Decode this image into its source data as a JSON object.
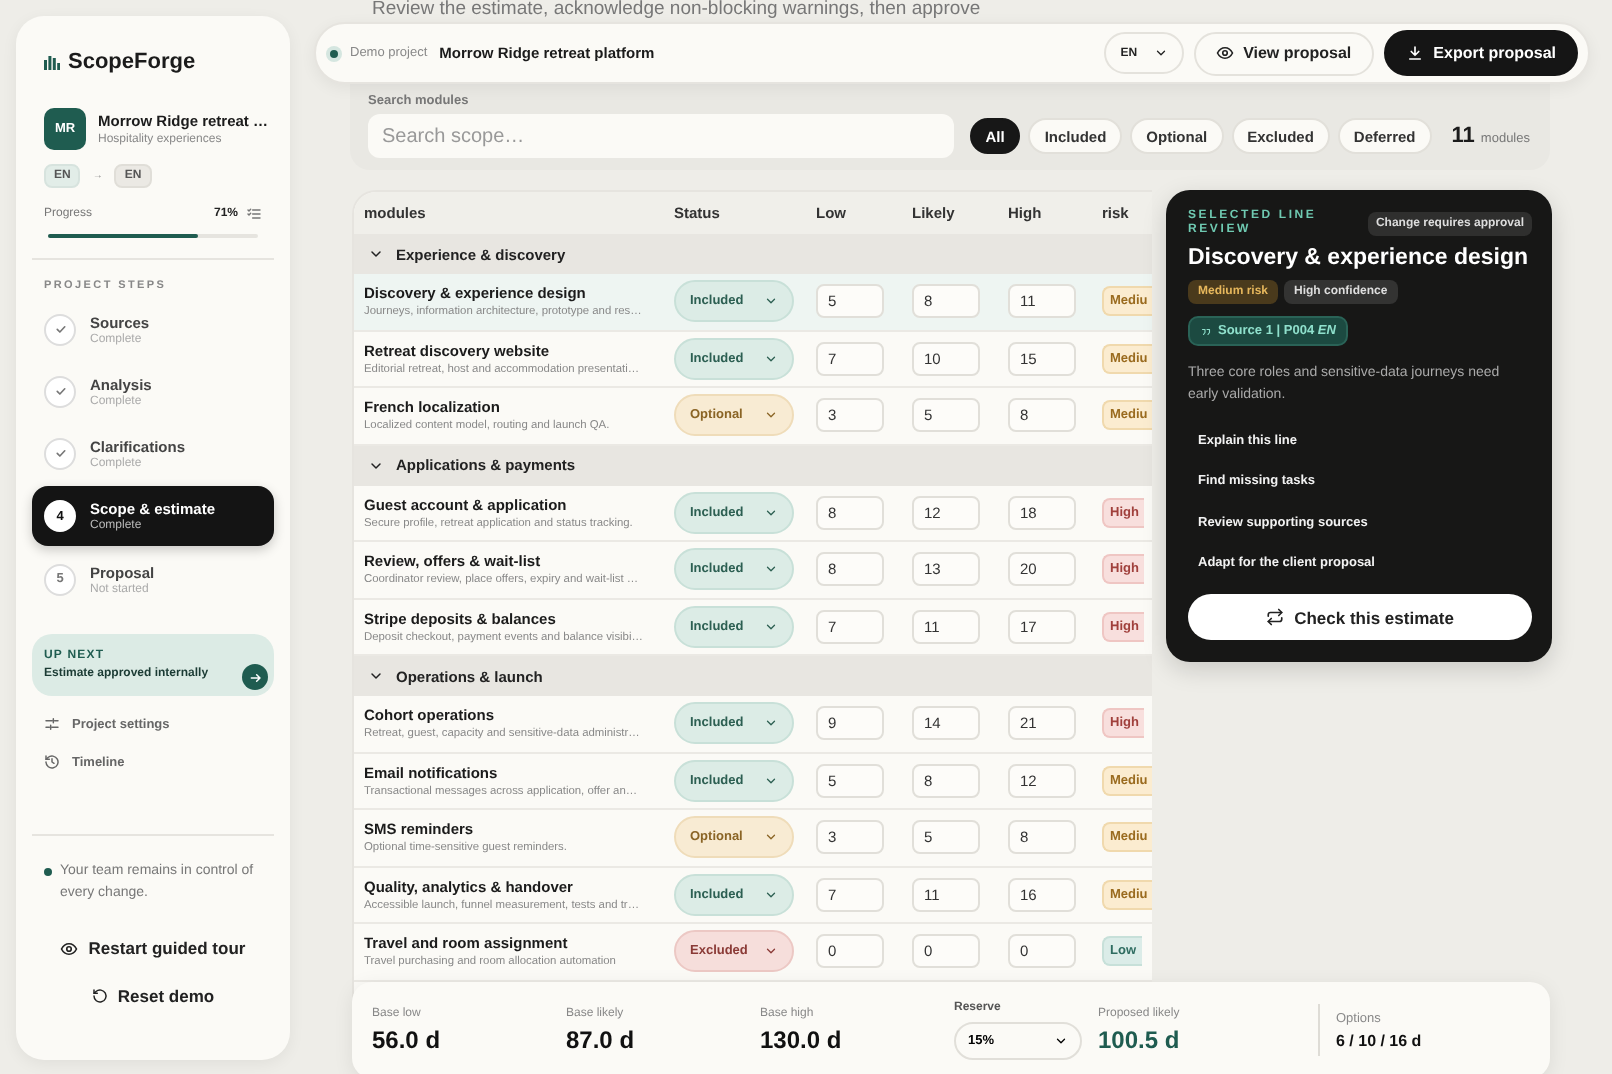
{
  "banner_text": "Review the estimate, acknowledge non-blocking warnings, then approve",
  "sidebar": {
    "brand": "ScopeForge",
    "project": {
      "initials": "MR",
      "name": "Morrow Ridge retreat …",
      "subtitle": "Hospitality experiences"
    },
    "languages": {
      "source": "EN",
      "arrow": "→",
      "target": "EN"
    },
    "progress": {
      "label": "Progress",
      "value": "71%",
      "level": 0.71
    },
    "steps_heading": "PROJECT STEPS",
    "steps": [
      {
        "kind": "done",
        "title": "Sources",
        "status": "Complete",
        "selected": false
      },
      {
        "kind": "done",
        "title": "Analysis",
        "status": "Complete",
        "selected": false
      },
      {
        "kind": "done",
        "title": "Clarifications",
        "status": "Complete",
        "selected": false
      },
      {
        "kind": "numbered",
        "number": "4",
        "title": "Scope & estimate",
        "status": "Complete",
        "selected": true
      },
      {
        "kind": "numbered",
        "number": "5",
        "title": "Proposal",
        "status": "Not started",
        "selected": false
      }
    ],
    "up_next": {
      "label": "UP NEXT",
      "text": "Estimate approved internally"
    },
    "links": [
      {
        "kind": "settings",
        "label": "Project settings"
      },
      {
        "kind": "timeline",
        "label": "Timeline"
      }
    ],
    "note": "Your team remains in control of every change.",
    "actions": [
      {
        "kind": "tour",
        "label": "Restart guided tour"
      },
      {
        "kind": "reset",
        "label": "Reset demo"
      }
    ]
  },
  "header": {
    "demo_label": "Demo project",
    "project_name": "Morrow Ridge retreat platform",
    "language": "EN",
    "buttons": [
      {
        "kind": "view",
        "label": "View proposal"
      },
      {
        "kind": "export",
        "label": "Export proposal"
      }
    ]
  },
  "search": {
    "label": "Search modules",
    "placeholder": "Search scope…",
    "filters": [
      {
        "label": "All",
        "selected": true
      },
      {
        "label": "Included",
        "selected": false
      },
      {
        "label": "Optional",
        "selected": false
      },
      {
        "label": "Excluded",
        "selected": false
      },
      {
        "label": "Deferred",
        "selected": false
      }
    ],
    "count": "11",
    "count_label": "modules"
  },
  "table": {
    "columns": [
      "modules",
      "Status",
      "Low",
      "Likely",
      "High",
      "risk"
    ],
    "groups": [
      {
        "title": "Experience & discovery",
        "expanded": true,
        "rows": [
          {
            "name": "Discovery & experience design",
            "description": "Journeys, information architecture, prototype and res…",
            "status": {
              "kind": "included",
              "label": "Included"
            },
            "low": "5",
            "likely": "8",
            "high": "11",
            "risk": {
              "kind": "medium",
              "label": "Mediu"
            },
            "selected": true
          },
          {
            "name": "Retreat discovery website",
            "description": "Editorial retreat, host and accommodation presentati…",
            "status": {
              "kind": "included",
              "label": "Included"
            },
            "low": "7",
            "likely": "10",
            "high": "15",
            "risk": {
              "kind": "medium",
              "label": "Mediu"
            },
            "selected": false
          },
          {
            "name": "French localization",
            "description": "Localized content model, routing and launch QA.",
            "status": {
              "kind": "optional",
              "label": "Optional"
            },
            "low": "3",
            "likely": "5",
            "high": "8",
            "risk": {
              "kind": "medium",
              "label": "Mediu"
            },
            "selected": false
          }
        ]
      },
      {
        "title": "Applications & payments",
        "expanded": true,
        "rows": [
          {
            "name": "Guest account & application",
            "description": "Secure profile, retreat application and status tracking.",
            "status": {
              "kind": "included",
              "label": "Included"
            },
            "low": "8",
            "likely": "12",
            "high": "18",
            "risk": {
              "kind": "high",
              "label": "High"
            },
            "selected": false
          },
          {
            "name": "Review, offers & wait-list",
            "description": "Coordinator review, place offers, expiry and wait-list …",
            "status": {
              "kind": "included",
              "label": "Included"
            },
            "low": "8",
            "likely": "13",
            "high": "20",
            "risk": {
              "kind": "high",
              "label": "High"
            },
            "selected": false
          },
          {
            "name": "Stripe deposits & balances",
            "description": "Deposit checkout, payment events and balance visibi…",
            "status": {
              "kind": "included",
              "label": "Included"
            },
            "low": "7",
            "likely": "11",
            "high": "17",
            "risk": {
              "kind": "high",
              "label": "High"
            },
            "selected": false
          }
        ]
      },
      {
        "title": "Operations & launch",
        "expanded": true,
        "rows": [
          {
            "name": "Cohort operations",
            "description": "Retreat, guest, capacity and sensitive-data administr…",
            "status": {
              "kind": "included",
              "label": "Included"
            },
            "low": "9",
            "likely": "14",
            "high": "21",
            "risk": {
              "kind": "high",
              "label": "High"
            },
            "selected": false
          },
          {
            "name": "Email notifications",
            "description": "Transactional messages across application, offer an…",
            "status": {
              "kind": "included",
              "label": "Included"
            },
            "low": "5",
            "likely": "8",
            "high": "12",
            "risk": {
              "kind": "medium",
              "label": "Mediu"
            },
            "selected": false
          },
          {
            "name": "SMS reminders",
            "description": "Optional time-sensitive guest reminders.",
            "status": {
              "kind": "optional",
              "label": "Optional"
            },
            "low": "3",
            "likely": "5",
            "high": "8",
            "risk": {
              "kind": "medium",
              "label": "Mediu"
            },
            "selected": false
          },
          {
            "name": "Quality, analytics & handover",
            "description": "Accessible launch, funnel measurement, tests and tr…",
            "status": {
              "kind": "included",
              "label": "Included"
            },
            "low": "7",
            "likely": "11",
            "high": "16",
            "risk": {
              "kind": "medium",
              "label": "Mediu"
            },
            "selected": false
          },
          {
            "name": "Travel and room assignment",
            "description": "Travel purchasing and room allocation automation",
            "status": {
              "kind": "excluded",
              "label": "Excluded"
            },
            "low": "0",
            "likely": "0",
            "high": "0",
            "risk": {
              "kind": "low",
              "label": "Low"
            },
            "selected": false
          }
        ]
      }
    ]
  },
  "review": {
    "eyebrow": "SELECTED LINE REVIEW",
    "approval_badge": "Change requires approval",
    "title": "Discovery & experience design",
    "tags": [
      {
        "kind": "risk",
        "label": "Medium risk"
      },
      {
        "kind": "confidence",
        "label": "High confidence"
      }
    ],
    "source": "Source 1 | P004 *EN*",
    "summary": "Three core roles and sensitive-data journeys need early validation.",
    "actions": [
      "Explain this line",
      "Find missing tasks",
      "Review supporting sources",
      "Adapt for the client proposal"
    ],
    "check_button": "Check this estimate"
  },
  "summary": {
    "items": [
      {
        "kind": "metric",
        "label": "Base low",
        "value": "56.0 d"
      },
      {
        "kind": "metric",
        "label": "Base likely",
        "value": "87.0 d"
      },
      {
        "kind": "metric",
        "label": "Base high",
        "value": "130.0 d"
      },
      {
        "kind": "select",
        "label": "Reserve",
        "value": "15%"
      },
      {
        "kind": "proposed",
        "label": "Proposed likely",
        "value": "100.5 d"
      },
      {
        "kind": "options",
        "label": "Options",
        "value": "6 / 10 / 16 d"
      }
    ]
  }
}
